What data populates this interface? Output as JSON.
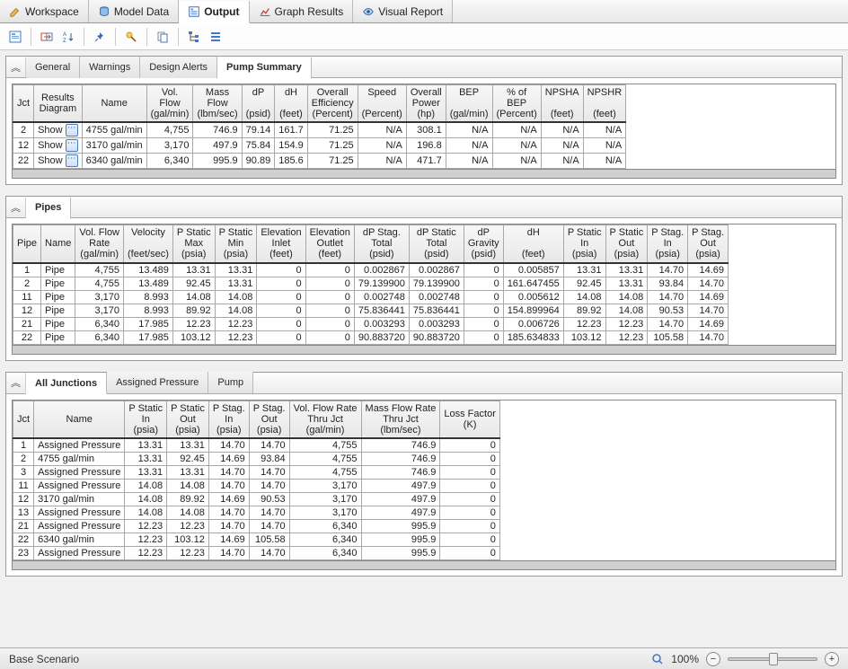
{
  "tabs": {
    "workspace": "Workspace",
    "model_data": "Model Data",
    "output": "Output",
    "graph_results": "Graph Results",
    "visual_report": "Visual Report"
  },
  "panel1": {
    "tabs": {
      "general": "General",
      "warnings": "Warnings",
      "design_alerts": "Design Alerts",
      "pump_summary": "Pump Summary"
    },
    "headers": [
      "Jct",
      "Results\nDiagram",
      "Name",
      "Vol.\nFlow\n(gal/min)",
      "Mass\nFlow\n(lbm/sec)",
      "dP\n\n(psid)",
      "dH\n\n(feet)",
      "Overall\nEfficiency\n(Percent)",
      "Speed\n\n(Percent)",
      "Overall\nPower\n(hp)",
      "BEP\n\n(gal/min)",
      "% of\nBEP\n(Percent)",
      "NPSHA\n\n(feet)",
      "NPSHR\n\n(feet)"
    ],
    "rows": [
      {
        "jct": "2",
        "diag": "Show",
        "name": "4755 gal/min",
        "vflow": "4,755",
        "mflow": "746.9",
        "dp": "79.14",
        "dh": "161.7",
        "eff": "71.25",
        "speed": "N/A",
        "pow": "308.1",
        "bep": "N/A",
        "pbep": "N/A",
        "npsha": "N/A",
        "npshr": "N/A"
      },
      {
        "jct": "12",
        "diag": "Show",
        "name": "3170 gal/min",
        "vflow": "3,170",
        "mflow": "497.9",
        "dp": "75.84",
        "dh": "154.9",
        "eff": "71.25",
        "speed": "N/A",
        "pow": "196.8",
        "bep": "N/A",
        "pbep": "N/A",
        "npsha": "N/A",
        "npshr": "N/A"
      },
      {
        "jct": "22",
        "diag": "Show",
        "name": "6340 gal/min",
        "vflow": "6,340",
        "mflow": "995.9",
        "dp": "90.89",
        "dh": "185.6",
        "eff": "71.25",
        "speed": "N/A",
        "pow": "471.7",
        "bep": "N/A",
        "pbep": "N/A",
        "npsha": "N/A",
        "npshr": "N/A"
      }
    ]
  },
  "panel2": {
    "tabs": {
      "pipes": "Pipes"
    },
    "headers": [
      "Pipe",
      "Name",
      "Vol. Flow\nRate\n(gal/min)",
      "Velocity\n\n(feet/sec)",
      "P Static\nMax\n(psia)",
      "P Static\nMin\n(psia)",
      "Elevation\nInlet\n(feet)",
      "Elevation\nOutlet\n(feet)",
      "dP Stag.\nTotal\n(psid)",
      "dP Static\nTotal\n(psid)",
      "dP\nGravity\n(psid)",
      "dH\n\n(feet)",
      "P Static\nIn\n(psia)",
      "P Static\nOut\n(psia)",
      "P Stag.\nIn\n(psia)",
      "P Stag.\nOut\n(psia)"
    ],
    "rows": [
      {
        "p": "1",
        "name": "Pipe",
        "vflow": "4,755",
        "vel": "13.489",
        "pmax": "13.31",
        "pmin": "13.31",
        "ein": "0",
        "eout": "0",
        "dpst": "0.002867",
        "dpstat": "0.002867",
        "dpg": "0",
        "dh": "0.005857",
        "psin": "13.31",
        "psout": "13.31",
        "pgin": "14.70",
        "pgout": "14.69"
      },
      {
        "p": "2",
        "name": "Pipe",
        "vflow": "4,755",
        "vel": "13.489",
        "pmax": "92.45",
        "pmin": "13.31",
        "ein": "0",
        "eout": "0",
        "dpst": "79.139900",
        "dpstat": "79.139900",
        "dpg": "0",
        "dh": "161.647455",
        "psin": "92.45",
        "psout": "13.31",
        "pgin": "93.84",
        "pgout": "14.70"
      },
      {
        "p": "11",
        "name": "Pipe",
        "vflow": "3,170",
        "vel": "8.993",
        "pmax": "14.08",
        "pmin": "14.08",
        "ein": "0",
        "eout": "0",
        "dpst": "0.002748",
        "dpstat": "0.002748",
        "dpg": "0",
        "dh": "0.005612",
        "psin": "14.08",
        "psout": "14.08",
        "pgin": "14.70",
        "pgout": "14.69"
      },
      {
        "p": "12",
        "name": "Pipe",
        "vflow": "3,170",
        "vel": "8.993",
        "pmax": "89.92",
        "pmin": "14.08",
        "ein": "0",
        "eout": "0",
        "dpst": "75.836441",
        "dpstat": "75.836441",
        "dpg": "0",
        "dh": "154.899964",
        "psin": "89.92",
        "psout": "14.08",
        "pgin": "90.53",
        "pgout": "14.70"
      },
      {
        "p": "21",
        "name": "Pipe",
        "vflow": "6,340",
        "vel": "17.985",
        "pmax": "12.23",
        "pmin": "12.23",
        "ein": "0",
        "eout": "0",
        "dpst": "0.003293",
        "dpstat": "0.003293",
        "dpg": "0",
        "dh": "0.006726",
        "psin": "12.23",
        "psout": "12.23",
        "pgin": "14.70",
        "pgout": "14.69"
      },
      {
        "p": "22",
        "name": "Pipe",
        "vflow": "6,340",
        "vel": "17.985",
        "pmax": "103.12",
        "pmin": "12.23",
        "ein": "0",
        "eout": "0",
        "dpst": "90.883720",
        "dpstat": "90.883720",
        "dpg": "0",
        "dh": "185.634833",
        "psin": "103.12",
        "psout": "12.23",
        "pgin": "105.58",
        "pgout": "14.70"
      }
    ]
  },
  "panel3": {
    "tabs": {
      "all_junctions": "All Junctions",
      "assigned_pressure": "Assigned Pressure",
      "pump": "Pump"
    },
    "headers": [
      "Jct",
      "Name",
      "P Static\nIn\n(psia)",
      "P Static\nOut\n(psia)",
      "P Stag.\nIn\n(psia)",
      "P Stag.\nOut\n(psia)",
      "Vol. Flow Rate\nThru Jct\n(gal/min)",
      "Mass Flow Rate\nThru Jct\n(lbm/sec)",
      "Loss Factor\n(K)"
    ],
    "rows": [
      {
        "j": "1",
        "name": "Assigned Pressure",
        "psin": "13.31",
        "psout": "13.31",
        "pgin": "14.70",
        "pgout": "14.70",
        "vf": "4,755",
        "mf": "746.9",
        "lf": "0"
      },
      {
        "j": "2",
        "name": "4755 gal/min",
        "psin": "13.31",
        "psout": "92.45",
        "pgin": "14.69",
        "pgout": "93.84",
        "vf": "4,755",
        "mf": "746.9",
        "lf": "0"
      },
      {
        "j": "3",
        "name": "Assigned Pressure",
        "psin": "13.31",
        "psout": "13.31",
        "pgin": "14.70",
        "pgout": "14.70",
        "vf": "4,755",
        "mf": "746.9",
        "lf": "0"
      },
      {
        "j": "11",
        "name": "Assigned Pressure",
        "psin": "14.08",
        "psout": "14.08",
        "pgin": "14.70",
        "pgout": "14.70",
        "vf": "3,170",
        "mf": "497.9",
        "lf": "0"
      },
      {
        "j": "12",
        "name": "3170 gal/min",
        "psin": "14.08",
        "psout": "89.92",
        "pgin": "14.69",
        "pgout": "90.53",
        "vf": "3,170",
        "mf": "497.9",
        "lf": "0"
      },
      {
        "j": "13",
        "name": "Assigned Pressure",
        "psin": "14.08",
        "psout": "14.08",
        "pgin": "14.70",
        "pgout": "14.70",
        "vf": "3,170",
        "mf": "497.9",
        "lf": "0"
      },
      {
        "j": "21",
        "name": "Assigned Pressure",
        "psin": "12.23",
        "psout": "12.23",
        "pgin": "14.70",
        "pgout": "14.70",
        "vf": "6,340",
        "mf": "995.9",
        "lf": "0"
      },
      {
        "j": "22",
        "name": "6340 gal/min",
        "psin": "12.23",
        "psout": "103.12",
        "pgin": "14.69",
        "pgout": "105.58",
        "vf": "6,340",
        "mf": "995.9",
        "lf": "0"
      },
      {
        "j": "23",
        "name": "Assigned Pressure",
        "psin": "12.23",
        "psout": "12.23",
        "pgin": "14.70",
        "pgout": "14.70",
        "vf": "6,340",
        "mf": "995.9",
        "lf": "0"
      }
    ]
  },
  "status": {
    "scenario": "Base Scenario",
    "zoom": "100%"
  }
}
